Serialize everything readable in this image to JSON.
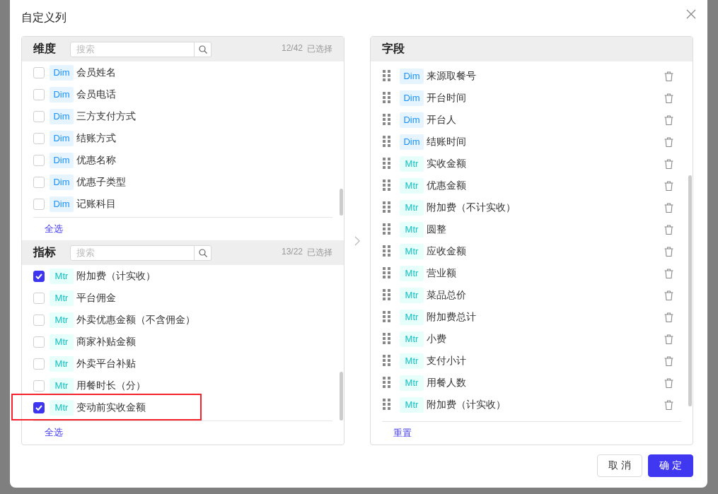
{
  "dialog": {
    "title": "自定义列"
  },
  "dimensions": {
    "title": "维度",
    "search_placeholder": "搜索",
    "count": "12/42",
    "count_label": "已选择",
    "select_all": "全选",
    "items": [
      {
        "kind": "dim",
        "tag": "Dim",
        "label": "会员姓名",
        "checked": false
      },
      {
        "kind": "dim",
        "tag": "Dim",
        "label": "会员电话",
        "checked": false
      },
      {
        "kind": "dim",
        "tag": "Dim",
        "label": "三方支付方式",
        "checked": false
      },
      {
        "kind": "dim",
        "tag": "Dim",
        "label": "结账方式",
        "checked": false
      },
      {
        "kind": "dim",
        "tag": "Dim",
        "label": "优惠名称",
        "checked": false
      },
      {
        "kind": "dim",
        "tag": "Dim",
        "label": "优惠子类型",
        "checked": false
      },
      {
        "kind": "dim",
        "tag": "Dim",
        "label": "记账科目",
        "checked": false
      }
    ]
  },
  "metrics": {
    "title": "指标",
    "search_placeholder": "搜索",
    "count": "13/22",
    "count_label": "已选择",
    "select_all": "全选",
    "items": [
      {
        "kind": "mtr",
        "tag": "Mtr",
        "label": "附加费（计实收）",
        "checked": true,
        "highlighted": false
      },
      {
        "kind": "mtr",
        "tag": "Mtr",
        "label": "平台佣金",
        "checked": false,
        "highlighted": false
      },
      {
        "kind": "mtr",
        "tag": "Mtr",
        "label": "外卖优惠金额（不含佣金）",
        "checked": false,
        "highlighted": false
      },
      {
        "kind": "mtr",
        "tag": "Mtr",
        "label": "商家补贴金额",
        "checked": false,
        "highlighted": false
      },
      {
        "kind": "mtr",
        "tag": "Mtr",
        "label": "外卖平台补贴",
        "checked": false,
        "highlighted": false
      },
      {
        "kind": "mtr",
        "tag": "Mtr",
        "label": "用餐时长（分）",
        "checked": false,
        "highlighted": false
      },
      {
        "kind": "mtr",
        "tag": "Mtr",
        "label": "变动前实收金额",
        "checked": true,
        "highlighted": true
      }
    ]
  },
  "fields": {
    "title": "字段",
    "reset": "重置",
    "items": [
      {
        "kind": "dim",
        "tag": "Dim",
        "label": "来源取餐号"
      },
      {
        "kind": "dim",
        "tag": "Dim",
        "label": "开台时间"
      },
      {
        "kind": "dim",
        "tag": "Dim",
        "label": "开台人"
      },
      {
        "kind": "dim",
        "tag": "Dim",
        "label": "结账时间"
      },
      {
        "kind": "mtr",
        "tag": "Mtr",
        "label": "实收金额"
      },
      {
        "kind": "mtr",
        "tag": "Mtr",
        "label": "优惠金额"
      },
      {
        "kind": "mtr",
        "tag": "Mtr",
        "label": "附加费（不计实收）"
      },
      {
        "kind": "mtr",
        "tag": "Mtr",
        "label": "圆整"
      },
      {
        "kind": "mtr",
        "tag": "Mtr",
        "label": "应收金额"
      },
      {
        "kind": "mtr",
        "tag": "Mtr",
        "label": "营业额"
      },
      {
        "kind": "mtr",
        "tag": "Mtr",
        "label": "菜品总价"
      },
      {
        "kind": "mtr",
        "tag": "Mtr",
        "label": "附加费总计"
      },
      {
        "kind": "mtr",
        "tag": "Mtr",
        "label": "小费"
      },
      {
        "kind": "mtr",
        "tag": "Mtr",
        "label": "支付小计"
      },
      {
        "kind": "mtr",
        "tag": "Mtr",
        "label": "用餐人数"
      },
      {
        "kind": "mtr",
        "tag": "Mtr",
        "label": "附加费（计实收）"
      }
    ]
  },
  "buttons": {
    "cancel": "取 消",
    "confirm": "确 定"
  }
}
